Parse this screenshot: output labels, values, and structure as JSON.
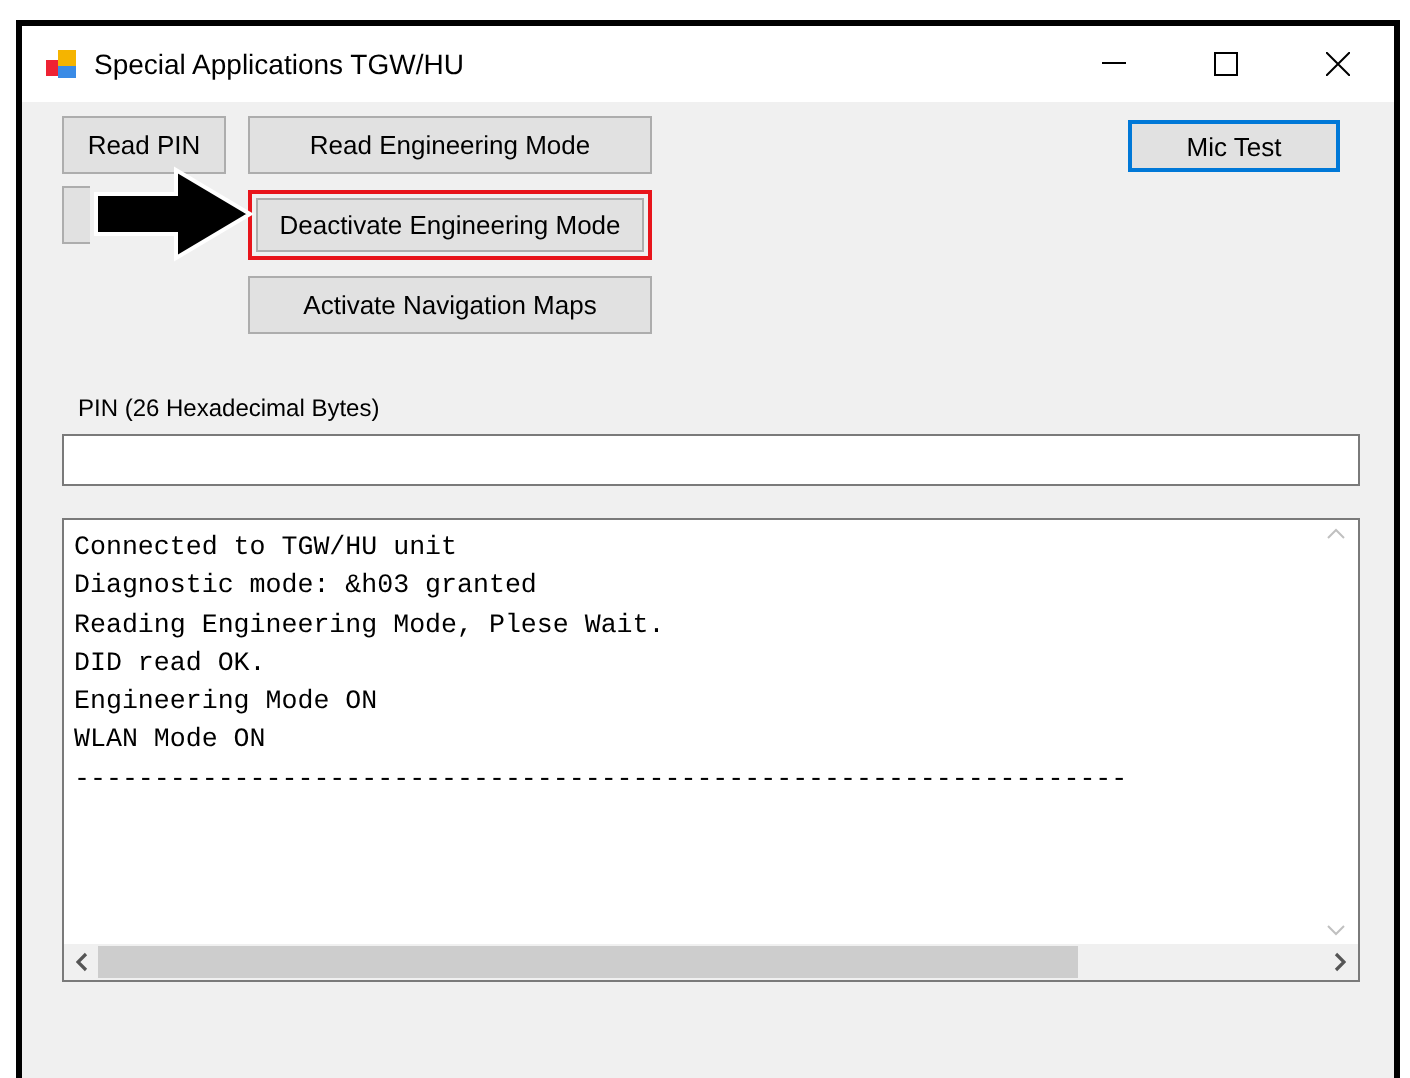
{
  "window": {
    "title": "Special Applications TGW/HU"
  },
  "left_buttons": [
    {
      "label": "Read PIN"
    }
  ],
  "mode_buttons": [
    {
      "label": "Read Engineering Mode",
      "highlighted": false
    },
    {
      "label": "Deactivate Engineering Mode",
      "highlighted": true
    },
    {
      "label": "Activate Navigation Maps",
      "highlighted": false
    }
  ],
  "mic_button": {
    "label": "Mic Test",
    "focused": true
  },
  "pin_field": {
    "label": "PIN (26 Hexadecimal Bytes)"
  },
  "log": {
    "lines": [
      "Connected to TGW/HU unit",
      "Diagnostic mode: &h03 granted",
      "Reading Engineering Mode, Plese Wait.",
      "DID read OK.",
      "Engineering Mode ON",
      "WLAN Mode ON",
      "------------------------------------------------------------------"
    ]
  }
}
